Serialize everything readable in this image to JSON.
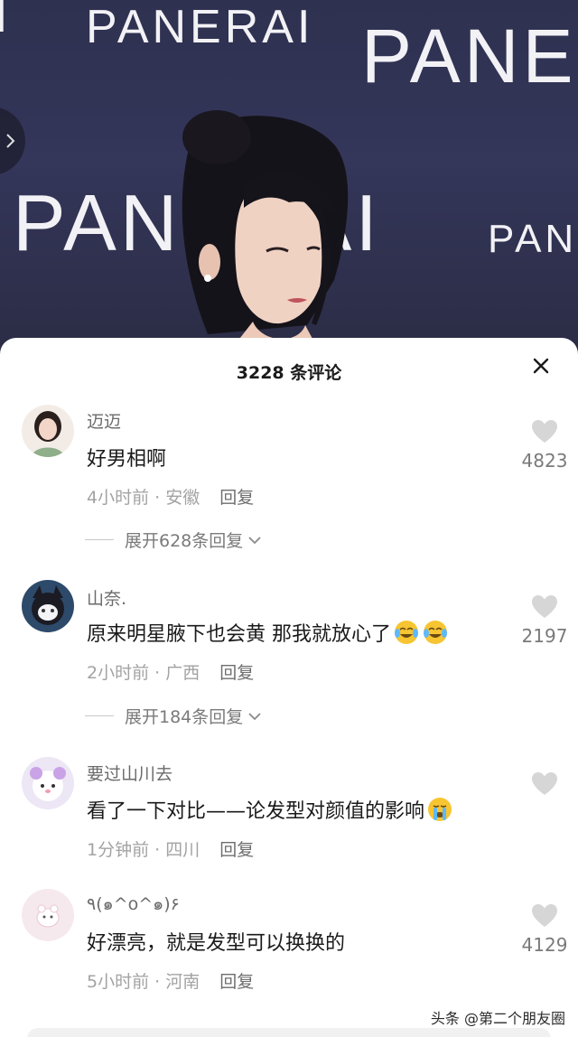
{
  "photo": {
    "backdrop_words": [
      "PANERAI",
      "PANE",
      "PANERAI",
      "PANE",
      "I"
    ]
  },
  "sheet": {
    "title": "3228 条评论"
  },
  "comments": [
    {
      "username": "迈迈",
      "text": "好男相啊",
      "time": "4小时前",
      "location": "安徽",
      "reply_label": "回复",
      "likes": "4823",
      "expand_label": "展开628条回复"
    },
    {
      "username": "山奈.",
      "text": "原来明星腋下也会黄 那我就放心了",
      "time": "2小时前",
      "location": "广西",
      "reply_label": "回复",
      "likes": "2197",
      "expand_label": "展开184条回复",
      "emoji": "crying-laughing-emoji"
    },
    {
      "username": "要过山川去",
      "text": "看了一下对比——论发型对颜值的影响",
      "time": "1分钟前",
      "location": "四川",
      "reply_label": "回复",
      "likes": "",
      "emoji": "crying-emoji"
    },
    {
      "username": "٩(๑^o^๑)۶",
      "text": "好漂亮，就是发型可以换换的",
      "time": "5小时前",
      "location": "河南",
      "reply_label": "回复",
      "likes": "4129"
    }
  ],
  "watermark": "头条 @第二个朋友圈",
  "colors": {
    "backdrop": "#2f3150",
    "like_icon": "#d6d6d6",
    "meta_text": "#a3a3a3"
  }
}
